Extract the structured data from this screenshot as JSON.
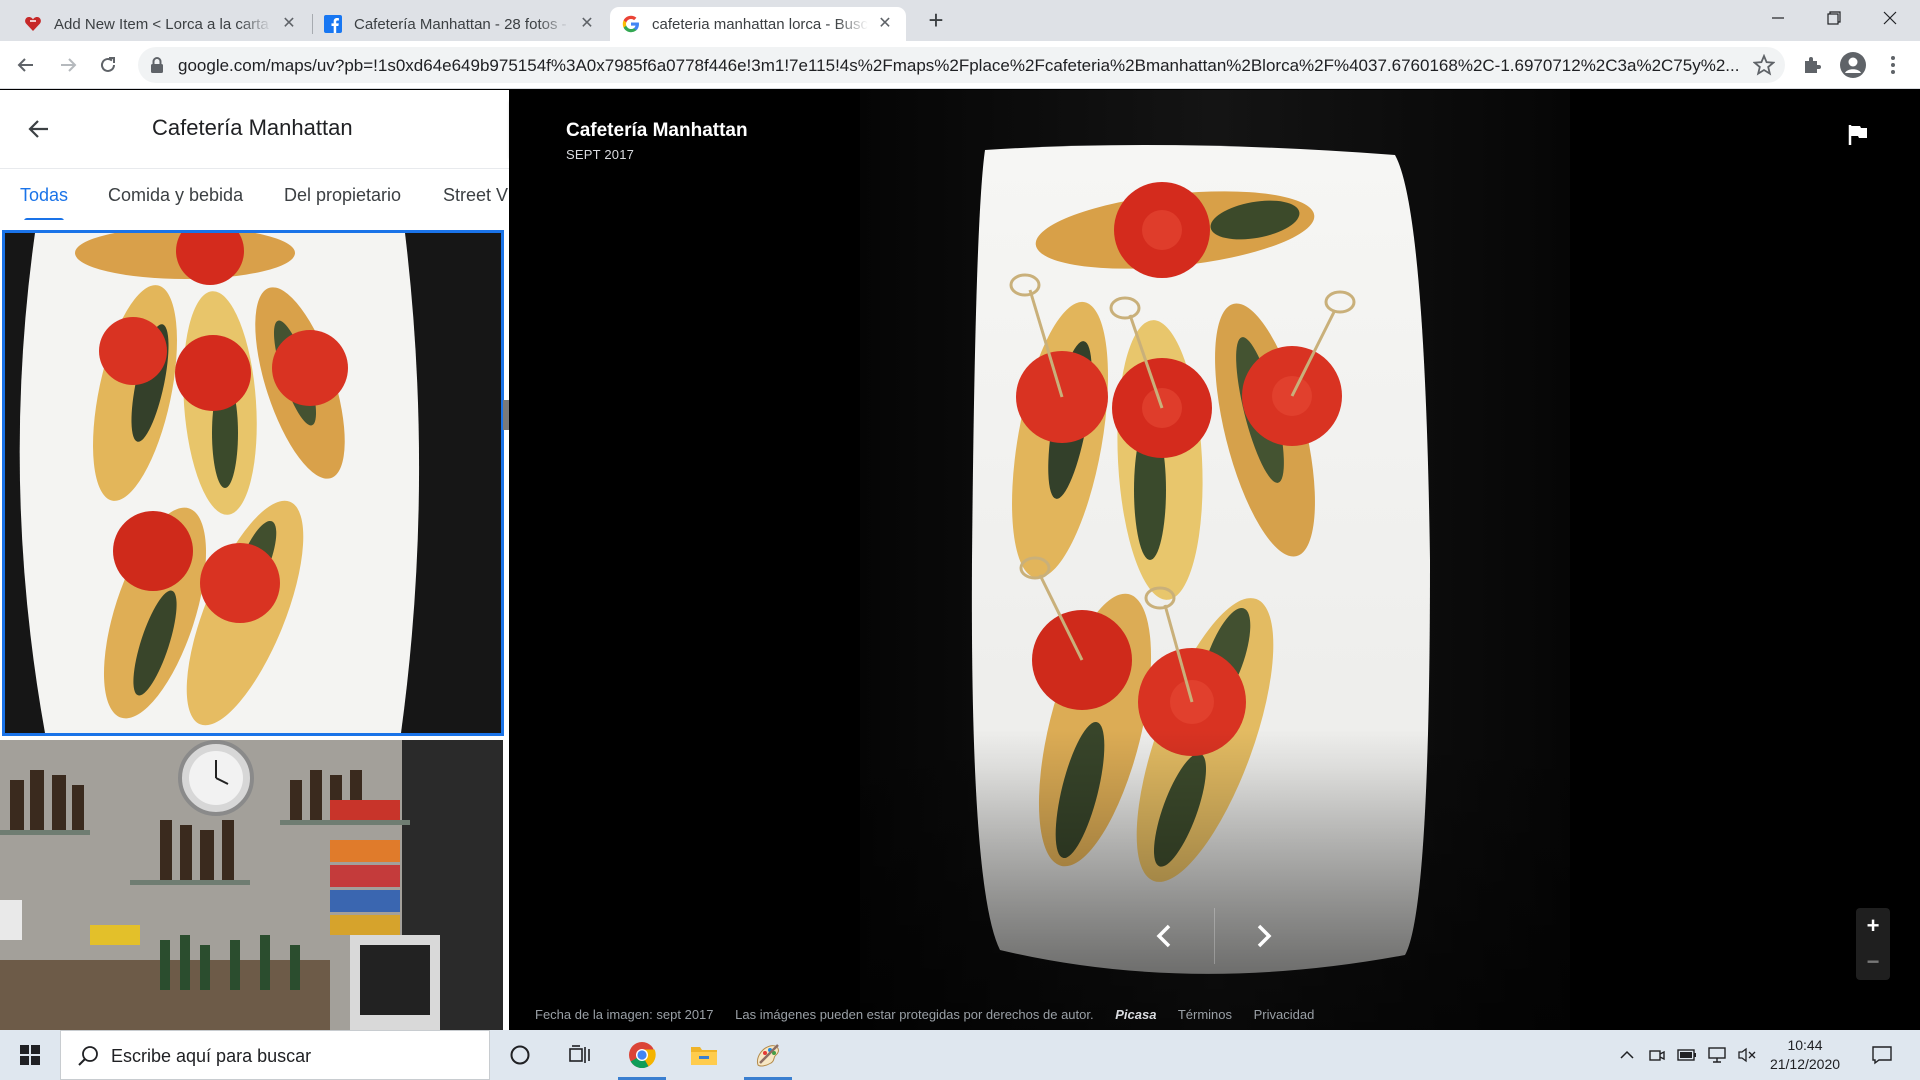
{
  "browser": {
    "tabs": [
      {
        "title": "Add New Item < Lorca a la carta",
        "icon": "site-heart-icon"
      },
      {
        "title": "Cafetería Manhattan - 28 fotos -",
        "icon": "facebook-icon"
      },
      {
        "title": "cafeteria manhattan lorca - Busca",
        "icon": "google-icon"
      }
    ],
    "url": "google.com/maps/uv?pb=!1s0xd64e649b975154f%3A0x7985f6a0778f446e!3m1!7e115!4s%2Fmaps%2Fplace%2Fcafeteria%2Bmanhattan%2Blorca%2F%4037.6760168%2C-1.6970712%2C3a%2C75y%2..."
  },
  "side_panel": {
    "title": "Cafetería Manhattan",
    "tabs": [
      "Todas",
      "Comida y bebida",
      "Del propietario",
      "Street V"
    ]
  },
  "viewer": {
    "title": "Cafetería Manhattan",
    "date": "SEPT 2017",
    "footer": {
      "image_date": "Fecha de la imagen: sept 2017",
      "copyright": "Las imágenes pueden estar protegidas por derechos de autor.",
      "source": "Picasa",
      "terms": "Términos",
      "privacy": "Privacidad"
    }
  },
  "taskbar": {
    "search_placeholder": "Escribe aquí para buscar",
    "time": "10:44",
    "date": "21/12/2020"
  },
  "colors": {
    "accent": "#1a73e8",
    "viewer_bg": "#000000",
    "tab_strip": "#dee1e6",
    "taskbar": "#dfe7ef"
  }
}
